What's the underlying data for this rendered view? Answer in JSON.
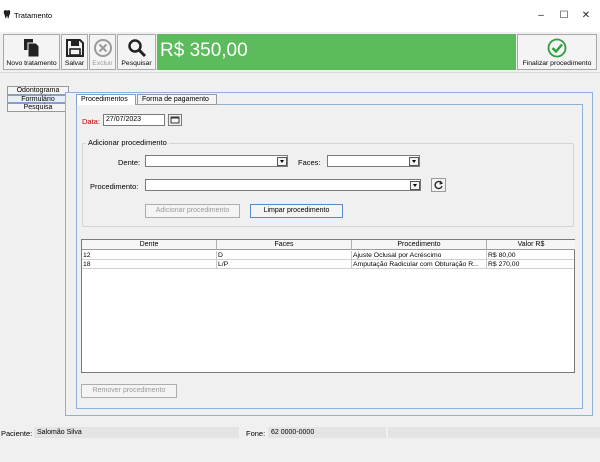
{
  "window": {
    "title": "Tratamento",
    "minimize": "–",
    "maximize": "☐",
    "close": "✕"
  },
  "toolbar": {
    "novo": "Novo tratamento",
    "salvar": "Salvar",
    "excluir": "Excluir",
    "pesquisar": "Pesquisar",
    "total": "R$ 350,00",
    "finalizar": "Finalizar procedimento",
    "colors": {
      "total_bg": "#5cbb5c",
      "check_green": "#2e9e3e"
    }
  },
  "side_tabs": [
    {
      "label": "Odontograma"
    },
    {
      "label": "Formulário"
    },
    {
      "label": "Pesquisa"
    }
  ],
  "tabs": [
    {
      "label": "Procedimentos"
    },
    {
      "label": "Forma de pagamento"
    }
  ],
  "form": {
    "data_label": "Data:",
    "data_value": "27/07/2023",
    "group_title": "Adicionar procedimento",
    "dente_label": "Dente:",
    "faces_label": "Faces:",
    "procedimento_label": "Procedimento:",
    "adicionar_btn": "Adicionar procedimento",
    "limpar_btn": "Limpar procedimento",
    "icons": {
      "calendar": "calendar-icon",
      "refresh": "refresh-icon"
    }
  },
  "table": {
    "headers": [
      "Dente",
      "Faces",
      "Procedimento",
      "Valor R$"
    ],
    "rows": [
      [
        "12",
        "D",
        "Ajuste Oclusal por Acréscimo",
        "R$ 80,00"
      ],
      [
        "18",
        "L/P",
        "Amputação Radicular com Obturação R...",
        "R$ 270,00"
      ]
    ]
  },
  "remover_btn": "Remover procedimento",
  "status": {
    "paciente_label": "Paciente:",
    "paciente_value": "Salomão Silva",
    "fone_label": "Fone:",
    "fone_value": "62 0000-0000"
  }
}
